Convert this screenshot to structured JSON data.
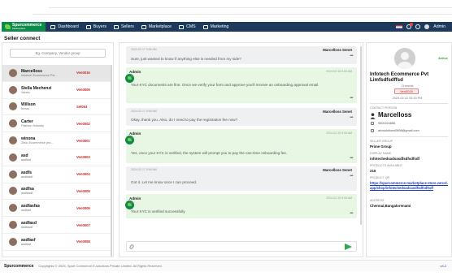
{
  "navbar": {
    "brand_line1": "Spurcommerce",
    "brand_line2": "Marketplace",
    "items": [
      {
        "label": "Dashboard",
        "icon": "dashboard-icon"
      },
      {
        "label": "Buyers",
        "icon": "buyers-icon"
      },
      {
        "label": "Sellers",
        "icon": "sellers-icon"
      },
      {
        "label": "Marketplace",
        "icon": "marketplace-icon"
      },
      {
        "label": "CMS",
        "icon": "cms-icon"
      },
      {
        "label": "Marketing",
        "icon": "marketing-icon"
      }
    ],
    "user_label": "Admin"
  },
  "page_title": "Seller connect",
  "search": {
    "placeholder": "Eg. Company, Vendor group"
  },
  "vendors": [
    {
      "name": "Marcelloss",
      "sub": "Infotech Ecommerce Pvt...",
      "code": "Ven0016"
    },
    {
      "name": "Stella Mechenzi",
      "sub": "Vanes",
      "code": "Ven0009"
    },
    {
      "name": "Willson",
      "sub": "brows",
      "code": "Sel063"
    },
    {
      "name": "Carter",
      "sub": "Fashion Industry",
      "code": "Ven0002"
    },
    {
      "name": "winona",
      "sub": "Zedo Ecommerce pro...",
      "code": "Ven0001"
    },
    {
      "name": "asd",
      "sub": "asdfasf",
      "code": "Ven0003"
    },
    {
      "name": "asdfs",
      "sub": "asdfasdf",
      "code": "Ven0004"
    },
    {
      "name": "asdfsa",
      "sub": "asdfasdf",
      "code": "Ven0005"
    },
    {
      "name": "asdfasfas",
      "sub": "asdfasf",
      "code": "Ven0006"
    },
    {
      "name": "asdfasd",
      "sub": "asdfasdf",
      "code": "Ven0007"
    },
    {
      "name": "asdfasf",
      "sub": "asdfasf",
      "code": "Ven0008"
    }
  ],
  "messages": [
    {
      "kind": "user",
      "time": "2024-02-17 5:56 AM",
      "sender": "Marcelloss Senet",
      "text": "Sure, just wanted to know if anything else is needed from my side?"
    },
    {
      "kind": "admin",
      "name": "Admin",
      "sub": "Me",
      "time": "2024-02-15 9:00 AM",
      "text": "Your KYC documents are fine. Once we verify your form and approve you'll receive an onboarding approval email."
    },
    {
      "kind": "user",
      "time": "2024-02-17 5:56 AM",
      "sender": "Marcelloss Senet",
      "text": "Okay, thank you. Also, do I need to pay the registration fee now?"
    },
    {
      "kind": "admin",
      "name": "Admin",
      "sub": "Me",
      "time": "2024-02-15 9:00 AM",
      "text": "Yes, once your KYC is verified, the system will prompt you to pay the one-time onboarding fee."
    },
    {
      "kind": "user",
      "time": "2024-02-17 5:56 AM",
      "sender": "Marcelloss Senet",
      "text": "Got it. Let me know once I can proceed."
    },
    {
      "kind": "admin",
      "name": "Admin",
      "sub": "Me",
      "time": "2024-02-15 9:00 AM",
      "text": "Your KYC is verified successfully"
    }
  ],
  "profile": {
    "status": "Active",
    "company": "Infotech Ecommerce Pvt Limfsdfsdffsd",
    "location": "Chennai",
    "code": "Ven0016",
    "date": "2024-02-12 05:33 PM",
    "contact_label": "CONTACT PERSON",
    "contact_name": "Marcelloss",
    "phone": "9500224856",
    "email": "aricsolutions0898@gmail.com",
    "seller_group_label": "SELLER GROUP",
    "seller_group": "Prime Group",
    "display_name_label": "DISPLAY NAME",
    "display_name": "infotechedsadsasdfsdfsdfsdf",
    "products_label": "PRODUCTS AVAILABLE",
    "products": "215",
    "product_qr_label": "PRODUCT QR",
    "product_qr": "https://spurcommerce-marketplace-store.vercel.app/shop/infotechedsadsasdfsdfsdfsdf",
    "address_label": "ADDRESS",
    "address": "Chennai,Bangalorenami"
  },
  "footer": {
    "brand": "Spurcommerce",
    "copyright": "Copyrights © 2025, Spurt Commerce E-solutions Private Limited. All Rights Reserved.",
    "version": "v4.2"
  }
}
